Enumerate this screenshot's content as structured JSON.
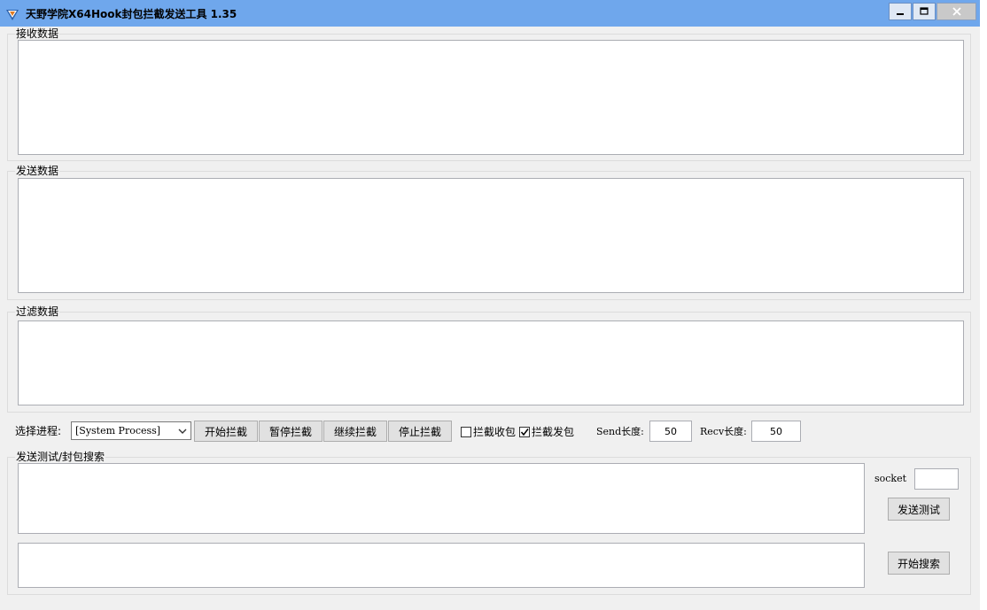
{
  "window": {
    "title": "天野学院X64Hook封包拦截发送工具  1.35",
    "minimize_icon": "minimize-icon",
    "maximize_icon": "maximize-icon",
    "close_icon": "close-icon"
  },
  "groups": {
    "recv": {
      "label": "接收数据"
    },
    "send": {
      "label": "发送数据"
    },
    "filter": {
      "label": "过滤数据"
    },
    "test": {
      "label": "发送测试/封包搜索"
    }
  },
  "controls": {
    "process_label": "选择进程:",
    "process_selected": "[System Process]",
    "start_label": "开始拦截",
    "pause_label": "暂停拦截",
    "resume_label": "继续拦截",
    "stop_label": "停止拦截",
    "intercept_recv_label": "拦截收包",
    "intercept_recv_checked": false,
    "intercept_send_label": "拦截发包",
    "intercept_send_checked": true,
    "send_len_label": "Send长度:",
    "send_len_value": "50",
    "recv_len_label": "Recv长度:",
    "recv_len_value": "50"
  },
  "test": {
    "socket_label": "socket",
    "socket_value": "",
    "send_test_label": "发送测试",
    "search_label": "开始搜索"
  }
}
